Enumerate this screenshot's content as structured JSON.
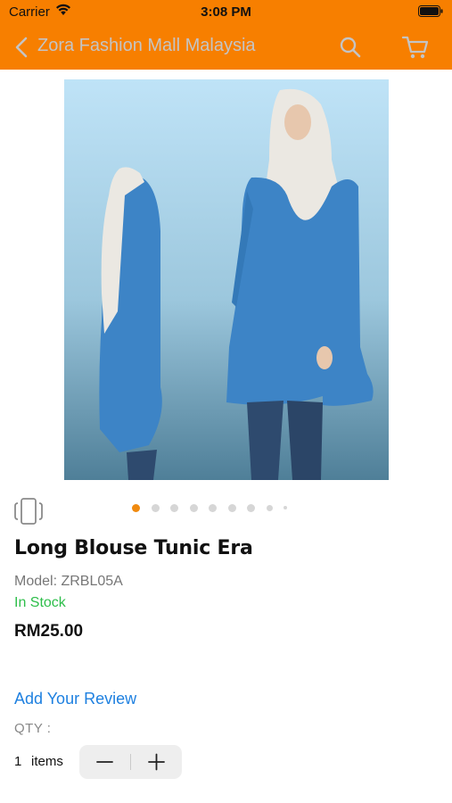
{
  "status_bar": {
    "carrier": "Carrier",
    "time": "3:08 PM",
    "icons": [
      "wifi-icon",
      "battery-icon"
    ]
  },
  "nav": {
    "title": "Zora Fashion Mall Malaysia",
    "icons": [
      "chevron-left-icon",
      "search-icon",
      "cart-icon"
    ],
    "accent_color": "#f77f00"
  },
  "gallery": {
    "page_count": 10,
    "current_page": 1,
    "active_color": "#f08a10"
  },
  "product": {
    "title": "Long Blouse Tunic Era",
    "model": "Model: ZRBL05A",
    "stock_status": "In Stock",
    "stock_color": "#2dbe4a",
    "price": "RM25.00"
  },
  "review": {
    "link_label": "Add Your Review",
    "link_color": "#1e80e0"
  },
  "quantity": {
    "label": "QTY :",
    "count": "1",
    "unit": "items",
    "minus_label": "−",
    "plus_label": "+"
  }
}
